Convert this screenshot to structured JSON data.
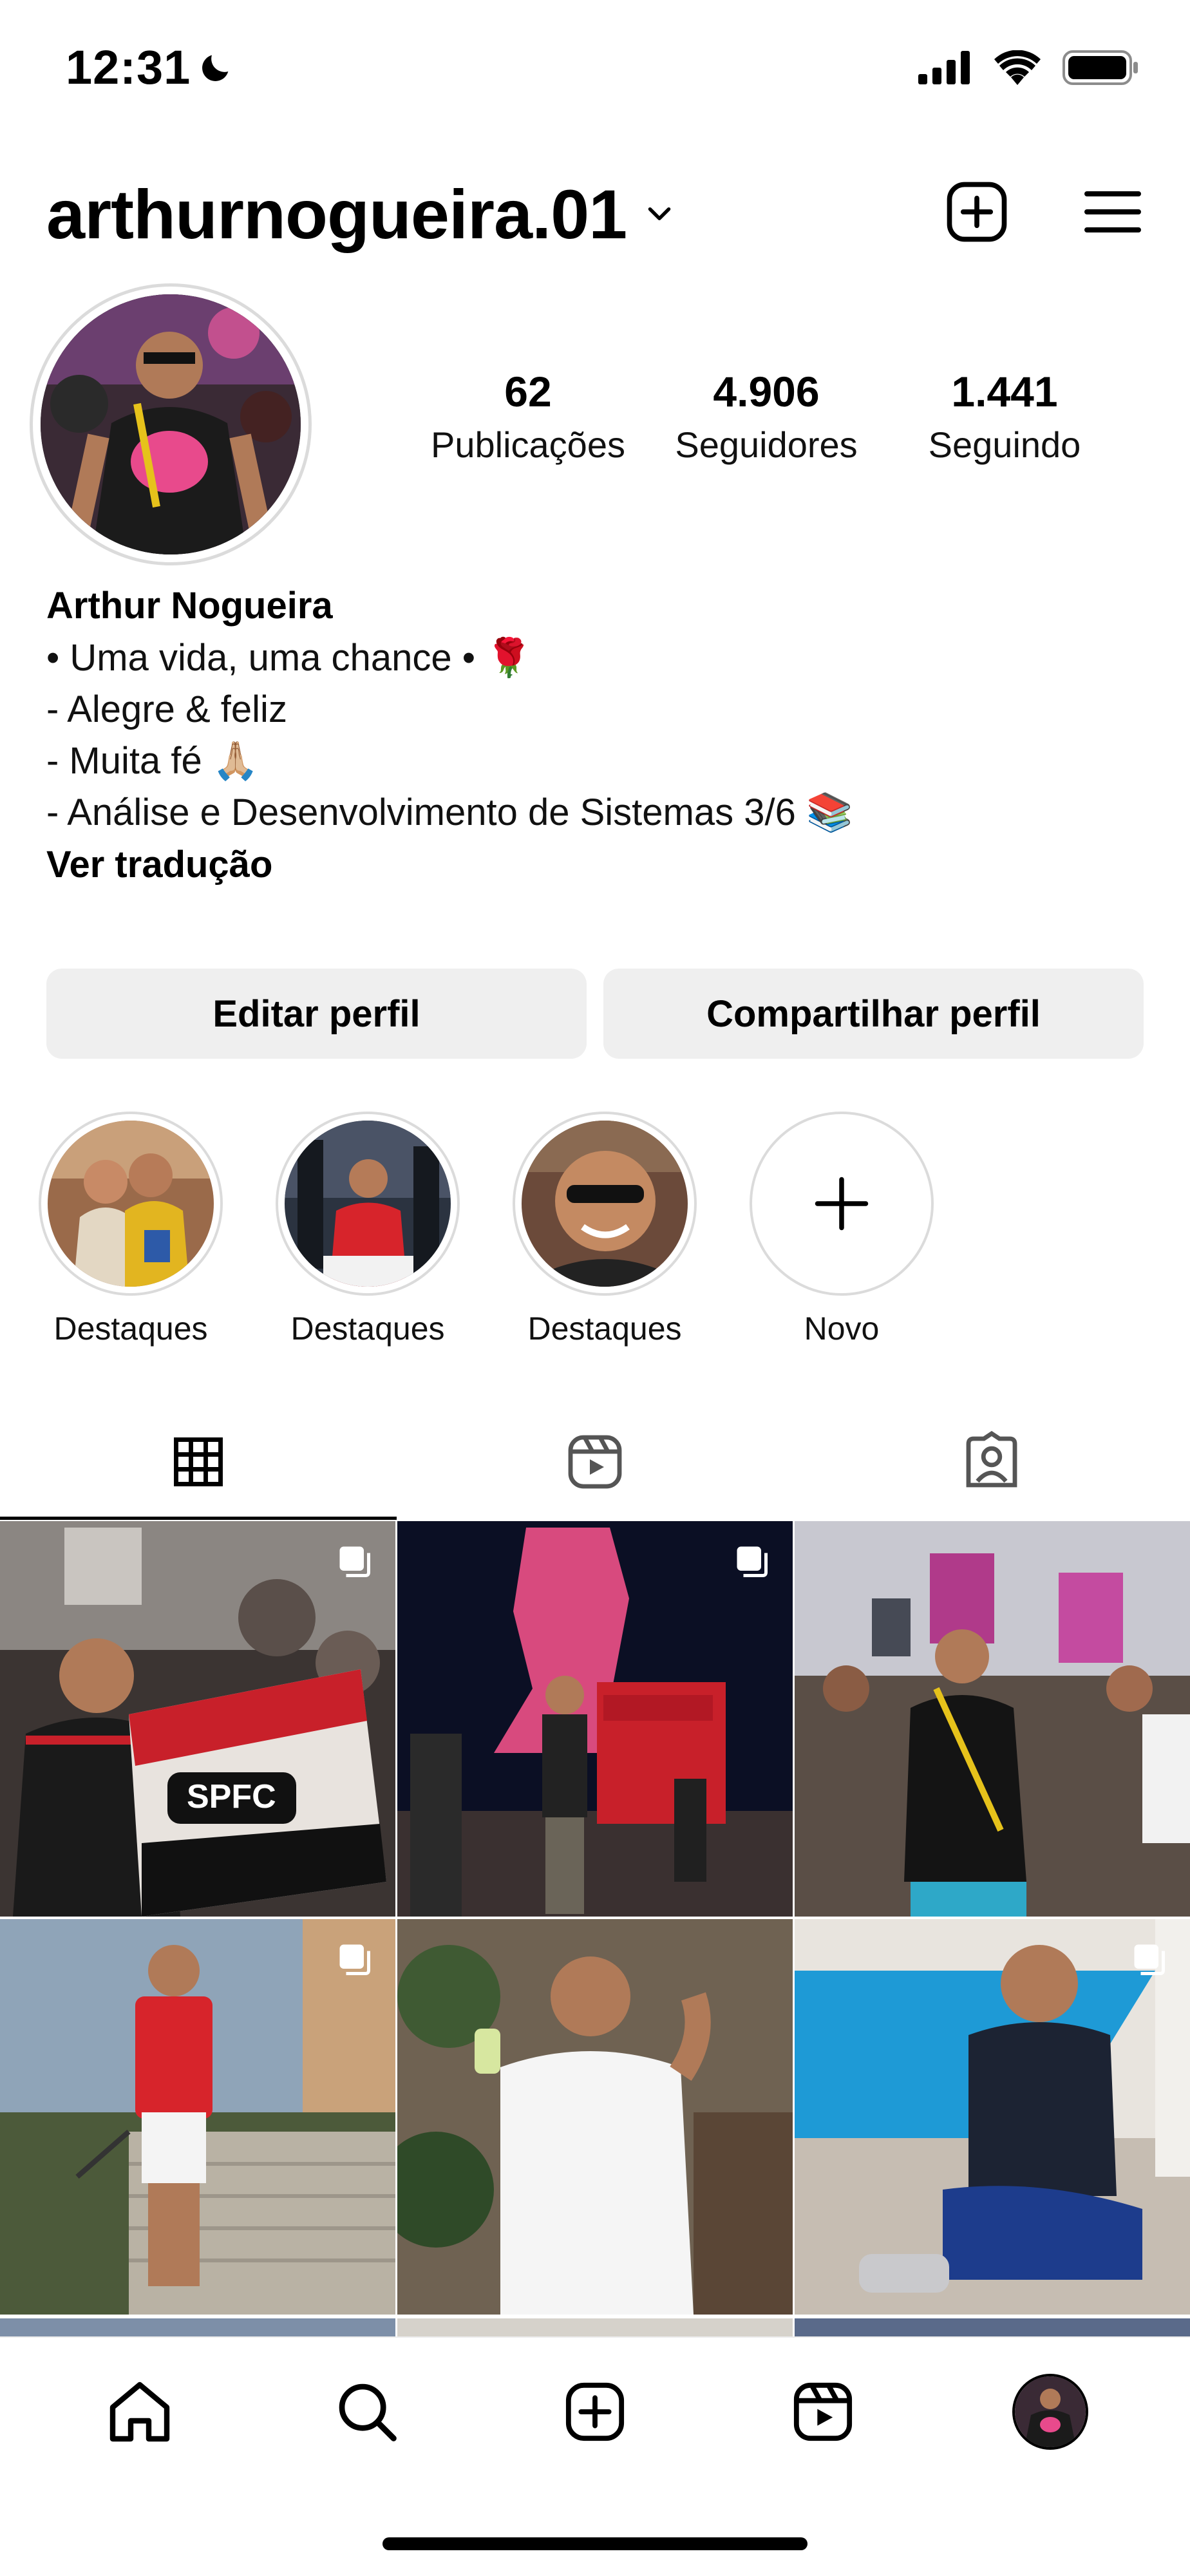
{
  "status_bar": {
    "time": "12:31",
    "icons": [
      "moon-icon",
      "cellular-signal-icon",
      "wifi-icon",
      "battery-icon"
    ]
  },
  "header": {
    "username": "arthurnogueira.01",
    "icons": [
      "chevron-down-icon",
      "create-post-icon",
      "menu-icon"
    ]
  },
  "stats": [
    {
      "value": "62",
      "label": "Publicações"
    },
    {
      "value": "4.906",
      "label": "Seguidores"
    },
    {
      "value": "1.441",
      "label": "Seguindo"
    }
  ],
  "bio": {
    "name": "Arthur Nogueira",
    "lines": [
      "• Uma vida, uma chance • 🌹",
      "- Alegre & feliz",
      "- Muita fé 🙏🏼",
      "- Análise e Desenvolvimento de Sistemas 3/6 📚"
    ],
    "translate_label": "Ver tradução"
  },
  "buttons": {
    "edit_profile": "Editar perfil",
    "share_profile": "Compartilhar perfil"
  },
  "highlights": [
    {
      "label": "Destaques"
    },
    {
      "label": "Destaques"
    },
    {
      "label": "Destaques"
    },
    {
      "label": "Novo"
    }
  ],
  "tabs": [
    {
      "name": "posts-grid-icon",
      "active": true
    },
    {
      "name": "reels-icon",
      "active": false
    },
    {
      "name": "tagged-icon",
      "active": false
    }
  ],
  "posts_count_visible": 6,
  "bottom_nav": [
    "home-icon",
    "search-icon",
    "create-icon",
    "reels-icon",
    "profile-avatar"
  ],
  "colors": {
    "button_bg": "#efefef",
    "ring_border": "#dbdbdb",
    "text": "#000000"
  }
}
